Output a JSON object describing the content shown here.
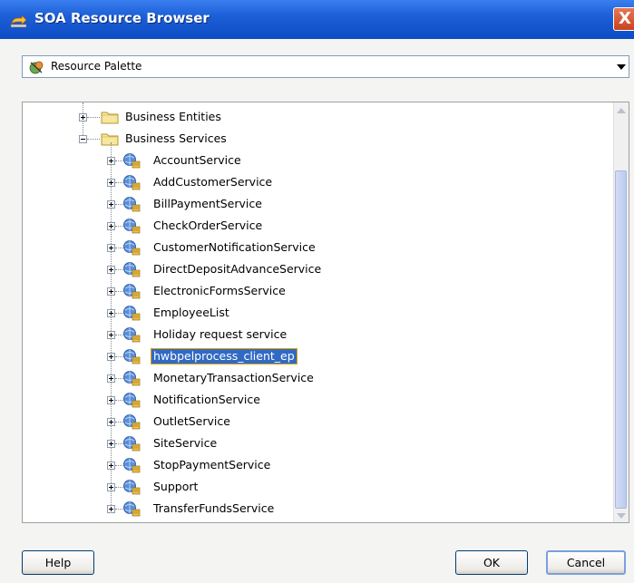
{
  "window": {
    "title": "SOA Resource Browser",
    "close_label": "X"
  },
  "combo": {
    "selected": "Resource Palette",
    "icon": "resource-palette-icon"
  },
  "tree": {
    "folders": [
      {
        "label": "Business Entities",
        "expanded": false
      },
      {
        "label": "Business Services",
        "expanded": true
      }
    ],
    "services": [
      "AccountService",
      "AddCustomerService",
      "BillPaymentService",
      "CheckOrderService",
      "CustomerNotificationService",
      "DirectDepositAdvanceService",
      "ElectronicFormsService",
      "EmployeeList",
      "Holiday request service",
      "hwbpelprocess_client_ep",
      "MonetaryTransactionService",
      "NotificationService",
      "OutletService",
      "SiteService",
      "StopPaymentService",
      "Support",
      "TransferFundsService"
    ],
    "selected": "hwbpelprocess_client_ep"
  },
  "buttons": {
    "help": "Help",
    "ok": "OK",
    "cancel": "Cancel"
  },
  "colors": {
    "titlebar": "#0d4cc4",
    "selection": "#316ac5"
  }
}
